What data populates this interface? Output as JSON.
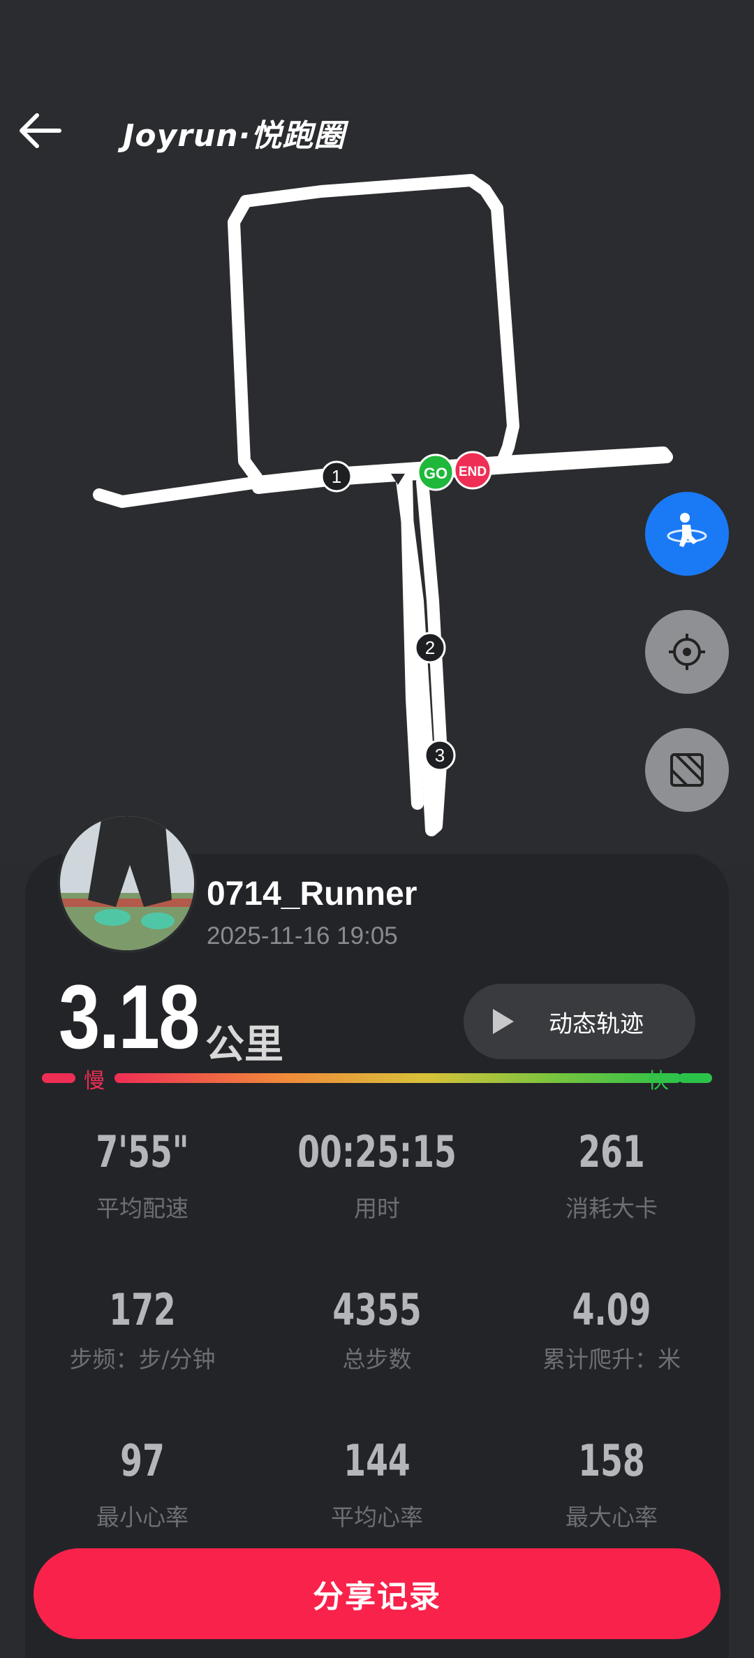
{
  "header": {
    "brand": "Joyrun·悦跑圈"
  },
  "map": {
    "start_marker": "GO",
    "end_marker": "END",
    "km_markers": [
      "1",
      "2",
      "3"
    ],
    "buttons": [
      "runner-view-icon",
      "locate-icon",
      "map-layer-icon"
    ]
  },
  "user": {
    "name": "0714_Runner",
    "datetime": "2025-11-16 19:05"
  },
  "summary": {
    "distance": "3.18",
    "distance_unit": "公里",
    "dynamic_track_label": "动态轨迹",
    "pace_slow": "慢",
    "pace_fast": "快"
  },
  "stats": [
    {
      "value": "7'55\"",
      "label": "平均配速"
    },
    {
      "value": "00:25:15",
      "label": "用时"
    },
    {
      "value": "261",
      "label": "消耗大卡"
    },
    {
      "value": "172",
      "label": "步频：步/分钟"
    },
    {
      "value": "4355",
      "label": "总步数"
    },
    {
      "value": "4.09",
      "label": "累计爬升：米"
    },
    {
      "value": "97",
      "label": "最小心率"
    },
    {
      "value": "144",
      "label": "平均心率"
    },
    {
      "value": "158",
      "label": "最大心率"
    }
  ],
  "share_label": "分享记录",
  "colors": {
    "accent": "#f8224b",
    "runner_button": "#1a7af5",
    "slow": "#ef2e55",
    "fast": "#2bc24a"
  }
}
